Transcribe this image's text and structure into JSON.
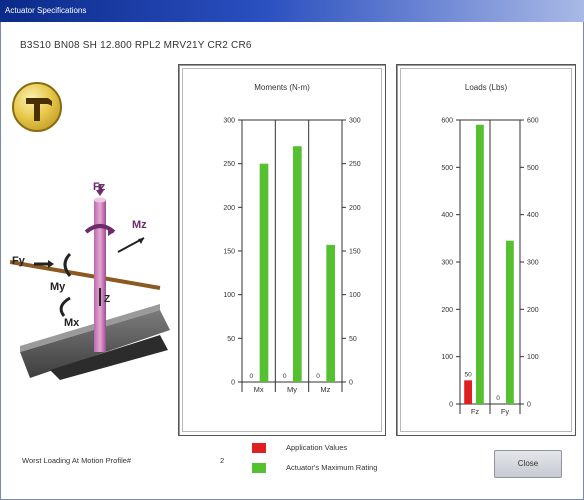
{
  "window": {
    "title": "Actuator Specifications"
  },
  "part_number": "B3S10 BN08 SH 12.800 RPL2 MRV21Y CR2 CR6",
  "diagram": {
    "labels": {
      "fz": "Fz",
      "mz": "Mz",
      "fy": "Fy",
      "my": "My",
      "mx": "Mx",
      "z": "Z"
    }
  },
  "chart_data": [
    {
      "type": "bar",
      "title": "Moments (N-m)",
      "categories": [
        "Mx",
        "My",
        "Mz"
      ],
      "ylim": [
        0,
        300
      ],
      "yticks": [
        0,
        50,
        100,
        150,
        200,
        250,
        300
      ],
      "series": [
        {
          "name": "Application Values",
          "color": "#e02020",
          "values": [
            0,
            0,
            0
          ],
          "value_labels": [
            "0",
            "0",
            "0"
          ]
        },
        {
          "name": "Actuator's Maximum Rating",
          "color": "#55c130",
          "values": [
            250,
            270,
            157
          ]
        }
      ]
    },
    {
      "type": "bar",
      "title": "Loads (Lbs)",
      "categories": [
        "Fz",
        "Fy"
      ],
      "ylim": [
        0,
        600
      ],
      "yticks": [
        0,
        100,
        200,
        300,
        400,
        500,
        600
      ],
      "series": [
        {
          "name": "Application Values",
          "color": "#e02020",
          "values": [
            50,
            0
          ],
          "value_labels": [
            "50",
            "0"
          ]
        },
        {
          "name": "Actuator's Maximum Rating",
          "color": "#55c130",
          "values": [
            590,
            345
          ]
        }
      ]
    }
  ],
  "legend": [
    {
      "label": "Application Values",
      "color": "#e02020"
    },
    {
      "label": "Actuator's Maximum Rating",
      "color": "#55c130"
    }
  ],
  "footer": {
    "loading_label": "Worst Loading At Motion Profile#",
    "loading_value": "2",
    "close_label": "Close"
  }
}
